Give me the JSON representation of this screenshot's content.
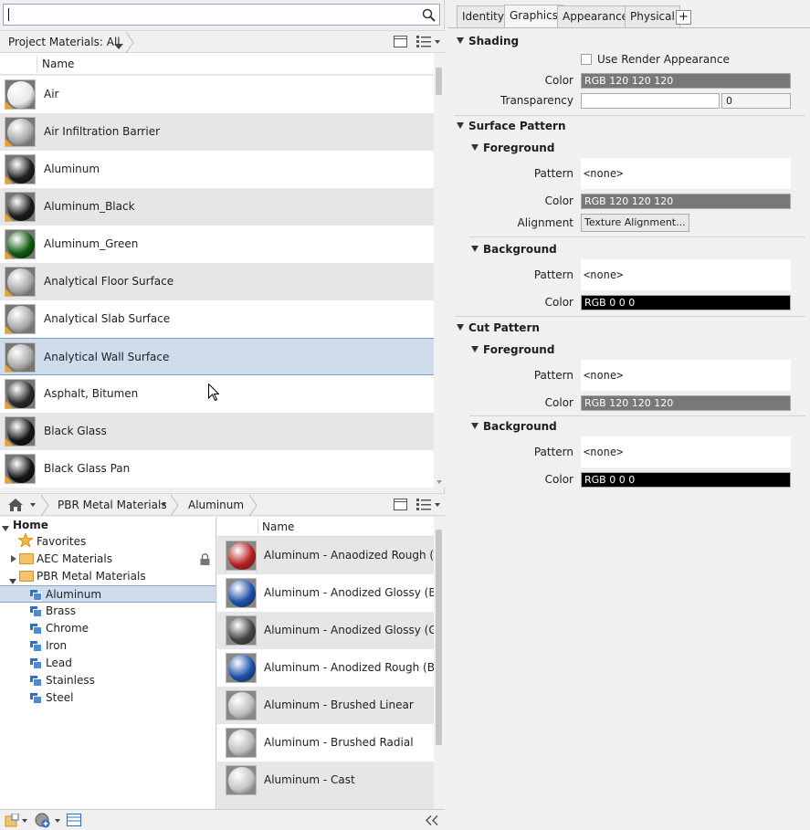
{
  "search": {
    "value": "",
    "placeholder": ""
  },
  "project_bar": {
    "label": "Project Materials: All"
  },
  "column": {
    "name": "Name"
  },
  "project_materials": [
    {
      "name": "Air",
      "thumb": "#e8e8e8"
    },
    {
      "name": "Air Infiltration Barrier",
      "thumb": "#a8a8a8"
    },
    {
      "name": "Aluminum",
      "thumb": "#1f1f1f"
    },
    {
      "name": "Aluminum_Black",
      "thumb": "#1c1c1c"
    },
    {
      "name": "Aluminum_Green",
      "thumb": "#0f5a12"
    },
    {
      "name": "Analytical Floor Surface",
      "thumb": "#a8a8a8"
    },
    {
      "name": "Analytical Slab Surface",
      "thumb": "#a8a8a8"
    },
    {
      "name": "Analytical Wall Surface",
      "thumb": "#a8a8a8"
    },
    {
      "name": "Asphalt, Bitumen",
      "thumb": "#2a2a2a"
    },
    {
      "name": "Black Glass",
      "thumb": "#151515"
    },
    {
      "name": "Black Glass Pan",
      "thumb": "#151515"
    }
  ],
  "library_bar": {
    "crumbs": [
      "PBR Metal Materials",
      "Aluminum"
    ]
  },
  "tree": {
    "home": "Home",
    "favorites": "Favorites",
    "aec": "AEC Materials",
    "pbr": "PBR Metal Materials",
    "children": [
      "Aluminum",
      "Brass",
      "Chrome",
      "Iron",
      "Lead",
      "Stainless",
      "Steel"
    ]
  },
  "library_materials": [
    {
      "name": "Aluminum - Anaodized Rough (Red",
      "thumb": "#b51f1f"
    },
    {
      "name": "Aluminum - Anodized Glossy (Blue",
      "thumb": "#1b4fa8"
    },
    {
      "name": "Aluminum - Anodized Glossy (Grey",
      "thumb": "#444444"
    },
    {
      "name": "Aluminum - Anodized Rough (Blue",
      "thumb": "#1b4fa8"
    },
    {
      "name": "Aluminum - Brushed Linear",
      "thumb": "#bdbdbd"
    },
    {
      "name": "Aluminum - Brushed Radial",
      "thumb": "#bdbdbd"
    },
    {
      "name": "Aluminum - Cast",
      "thumb": "#c4c4c4"
    }
  ],
  "tabs": [
    "Identity",
    "Graphics",
    "Appearance",
    "Physical",
    "+"
  ],
  "graphics": {
    "shading": "Shading",
    "use_render": "Use Render Appearance",
    "color_label": "Color",
    "transparency_label": "Transparency",
    "shading_color": "RGB 120 120 120",
    "transparency_value": "0",
    "surface_pattern": "Surface Pattern",
    "foreground": "Foreground",
    "background": "Background",
    "pattern_label": "Pattern",
    "alignment_label": "Alignment",
    "none": "<none>",
    "grey_color": "RGB 120 120 120",
    "black_color": "RGB 0 0 0",
    "texture_alignment": "Texture Alignment...",
    "cut_pattern": "Cut Pattern"
  },
  "colors": {
    "accent": "#cfdcec",
    "grey_swatch": "#787878",
    "black_swatch": "#000000"
  }
}
